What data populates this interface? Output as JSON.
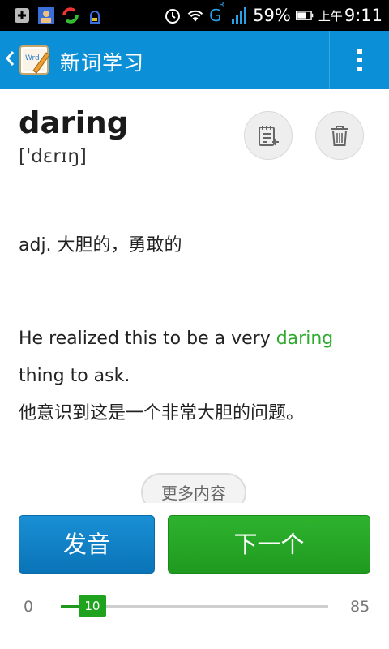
{
  "status_bar": {
    "network_label": "G",
    "roaming_label": "R",
    "battery_percent": "59%",
    "ampm": "上午",
    "time": "9:11",
    "left_icons": [
      "notification-plus-icon",
      "contact-card-icon",
      "sync-app-icon",
      "bug-icon"
    ],
    "right_icons": [
      "alarm-icon",
      "wifi-icon",
      "signal-icon",
      "battery-icon"
    ]
  },
  "action_bar": {
    "title": "新词学习",
    "background": "#0b8fd6"
  },
  "word": {
    "text": "daring",
    "phonetic": "['dɛrɪŋ]"
  },
  "definition": "adj. 大胆的，勇敢的",
  "example": {
    "before": "He realized this to be a very ",
    "highlight": "daring",
    "after": " thing to ask.",
    "translation": "他意识到这是一个非常大胆的问题。",
    "highlight_color": "#2eaa2e"
  },
  "more_label": "更多内容",
  "buttons": {
    "pronounce": "发音",
    "next": "下一个"
  },
  "progress": {
    "min": "0",
    "max": "85",
    "current": "10",
    "fraction": 0.118
  },
  "colors": {
    "accent_blue": "#0b8fd6",
    "accent_green": "#1f9a1f"
  }
}
